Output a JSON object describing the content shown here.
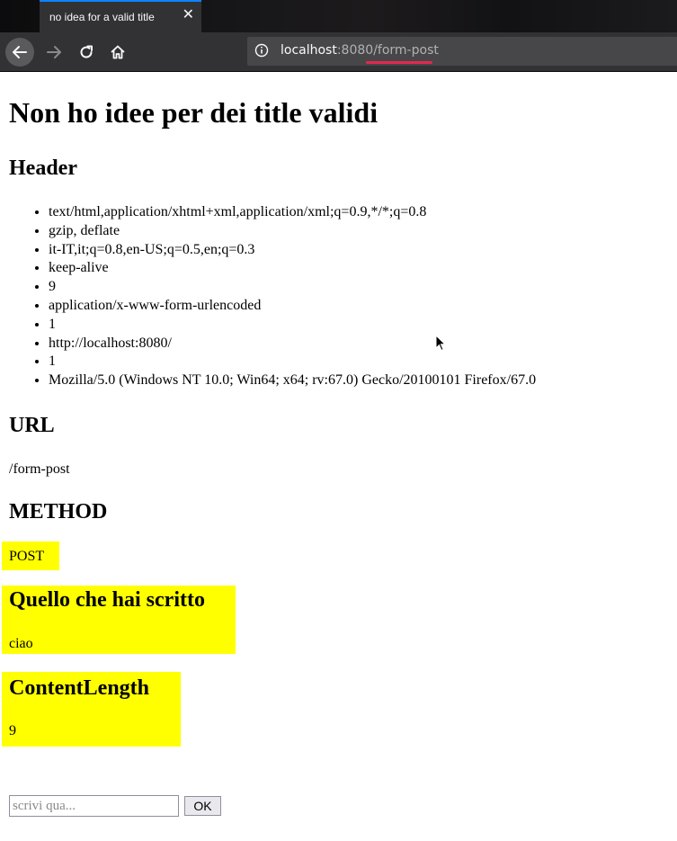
{
  "browser": {
    "tab_title": "no idea for a valid title",
    "tab_close": "✕",
    "url_host": "localhost",
    "url_port": ":8080",
    "url_path": "/form-post"
  },
  "page": {
    "title": "Non ho idee per dei title validi",
    "header_heading": "Header",
    "headers": [
      "text/html,application/xhtml+xml,application/xml;q=0.9,*/*;q=0.8",
      "gzip, deflate",
      "it-IT,it;q=0.8,en-US;q=0.5,en;q=0.3",
      "keep-alive",
      "9",
      "application/x-www-form-urlencoded",
      "1",
      "http://localhost:8080/",
      "1",
      "Mozilla/5.0 (Windows NT 10.0; Win64; x64; rv:67.0) Gecko/20100101 Firefox/67.0"
    ],
    "url_heading": "URL",
    "url_value": "/form-post",
    "method_heading": "METHOD",
    "method_value": "POST",
    "written_heading": "Quello che hai scritto",
    "written_value": "ciao",
    "content_length_heading": "ContentLength",
    "content_length_value": "9",
    "form": {
      "placeholder": "scrivi qua...",
      "value": "",
      "submit_label": "OK"
    }
  },
  "colors": {
    "highlight": "#ffff00",
    "chrome_dark": "#0c0c0d",
    "toolbar": "#323234",
    "url_underline": "#e22850"
  }
}
